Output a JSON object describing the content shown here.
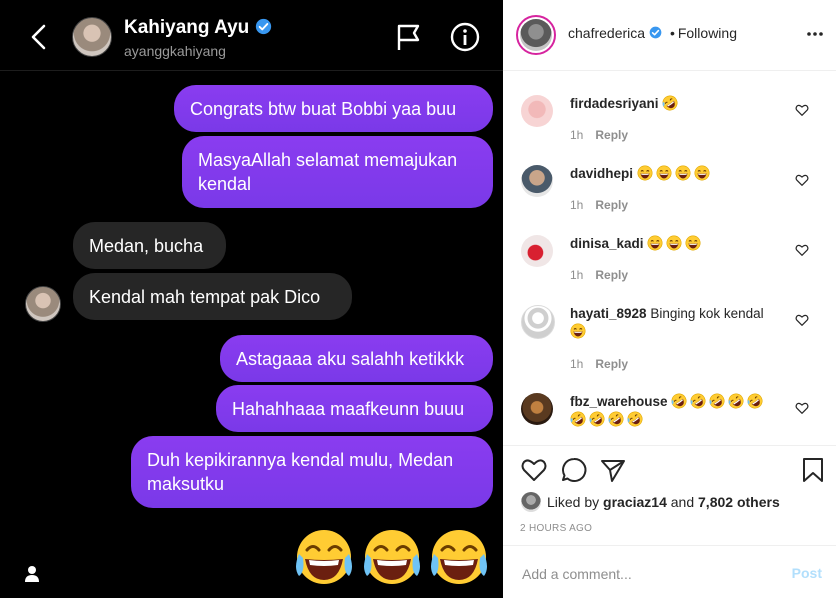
{
  "chat": {
    "name": "Kahiyang Ayu",
    "handle": "ayanggkahiyang",
    "messages": [
      {
        "from": "me",
        "text": "Congrats btw buat Bobbi yaa buu"
      },
      {
        "from": "me",
        "text": "MasyaAllah selamat memajukan kendal"
      },
      {
        "from": "them",
        "text": "Medan, bucha"
      },
      {
        "from": "them",
        "text": "Kendal mah tempat pak Dico"
      },
      {
        "from": "me",
        "text": "Astagaaa aku salahh ketikkk"
      },
      {
        "from": "me",
        "text": "Hahahhaaa maafkeunn buuu"
      },
      {
        "from": "me",
        "text": "Duh kepikirannya kendal mulu, Medan maksutku"
      }
    ],
    "emoji_count": 3,
    "emoji_name": "face-with-tears-of-joy"
  },
  "post": {
    "username": "chafrederica",
    "follow_status": "Following",
    "separator": "•",
    "comments": [
      {
        "user": "firdadesriyani",
        "text": "",
        "emoji": 1,
        "time": "1h",
        "reply": "Reply"
      },
      {
        "user": "davidhepi",
        "text": "",
        "emoji": 4,
        "emoji_type": "grin",
        "time": "1h",
        "reply": "Reply"
      },
      {
        "user": "dinisa_kadi",
        "text": "",
        "emoji": 3,
        "emoji_type": "grin",
        "time": "1h",
        "reply": "Reply"
      },
      {
        "user": "hayati_8928",
        "text": "Binging kok kendal",
        "emoji": 1,
        "emoji_type": "grin",
        "time": "1h",
        "reply": "Reply"
      },
      {
        "user": "fbz_warehouse",
        "text": "",
        "emoji": 9,
        "emoji_type": "rofl"
      }
    ],
    "likes": {
      "prefix": "Liked by",
      "user": "graciaz14",
      "joiner": "and",
      "others": "7,802 others"
    },
    "time_ago": "2 HOURS AGO",
    "comment_placeholder": "Add a comment...",
    "post_label": "Post",
    "colors": {
      "accent_purple": "#7a39e8",
      "verified_blue": "#3897f0",
      "post_disabled": "#b2dffc"
    }
  }
}
